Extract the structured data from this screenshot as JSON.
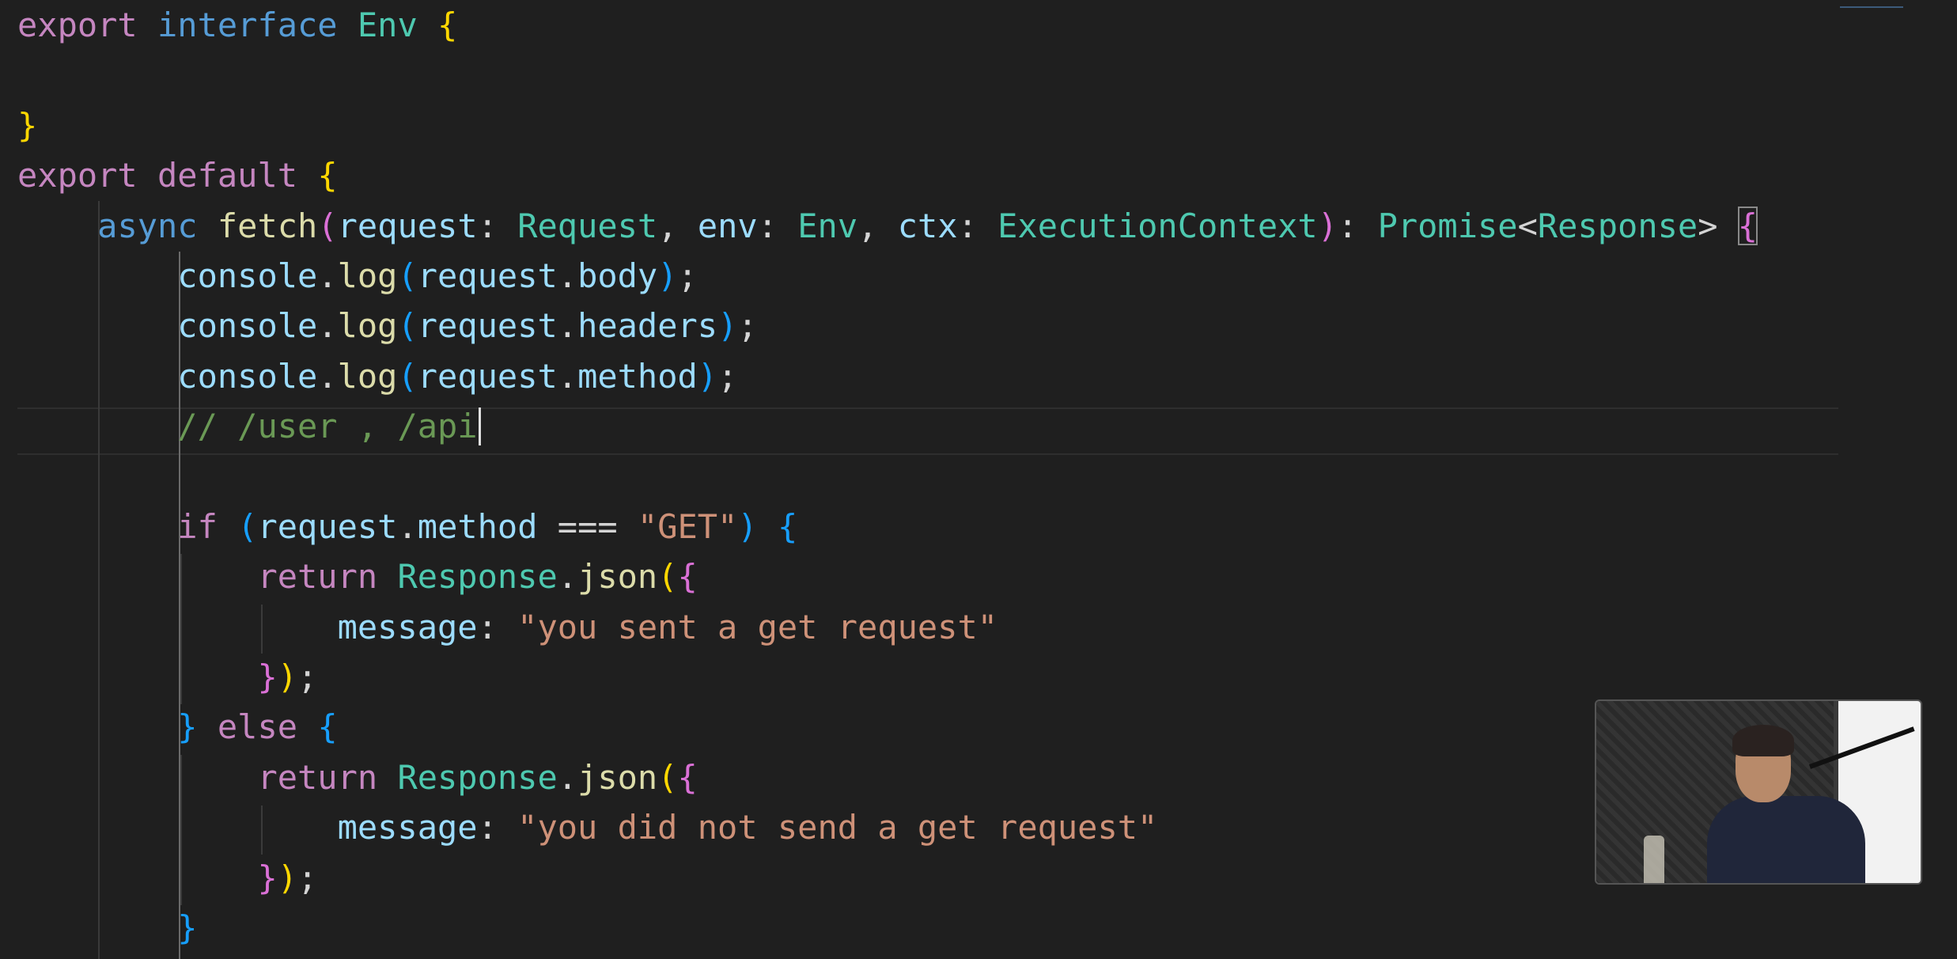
{
  "editor": {
    "code_lines": [
      [
        {
          "t": "export",
          "c": "kw"
        },
        {
          "t": " "
        },
        {
          "t": "interface",
          "c": "kw2"
        },
        {
          "t": " "
        },
        {
          "t": "Env",
          "c": "type"
        },
        {
          "t": " "
        },
        {
          "t": "{",
          "c": "b1"
        }
      ],
      [],
      [
        {
          "t": "}",
          "c": "b1"
        }
      ],
      [
        {
          "t": "export",
          "c": "kw"
        },
        {
          "t": " "
        },
        {
          "t": "default",
          "c": "kw"
        },
        {
          "t": " "
        },
        {
          "t": "{",
          "c": "b1"
        }
      ],
      [
        {
          "t": "    "
        },
        {
          "t": "async",
          "c": "kw2"
        },
        {
          "t": " "
        },
        {
          "t": "fetch",
          "c": "fn"
        },
        {
          "t": "(",
          "c": "b2"
        },
        {
          "t": "request",
          "c": "var"
        },
        {
          "t": ": "
        },
        {
          "t": "Request",
          "c": "type"
        },
        {
          "t": ", "
        },
        {
          "t": "env",
          "c": "var"
        },
        {
          "t": ": "
        },
        {
          "t": "Env",
          "c": "type"
        },
        {
          "t": ", "
        },
        {
          "t": "ctx",
          "c": "var"
        },
        {
          "t": ": "
        },
        {
          "t": "ExecutionContext",
          "c": "type"
        },
        {
          "t": ")",
          "c": "b2"
        },
        {
          "t": ": "
        },
        {
          "t": "Promise",
          "c": "type"
        },
        {
          "t": "<"
        },
        {
          "t": "Response",
          "c": "type"
        },
        {
          "t": ">"
        },
        {
          "t": " "
        },
        {
          "t": "{",
          "c": "b2 bracket-match"
        }
      ],
      [
        {
          "t": "        "
        },
        {
          "t": "console",
          "c": "var"
        },
        {
          "t": "."
        },
        {
          "t": "log",
          "c": "fn"
        },
        {
          "t": "(",
          "c": "b3"
        },
        {
          "t": "request",
          "c": "var"
        },
        {
          "t": "."
        },
        {
          "t": "body",
          "c": "var"
        },
        {
          "t": ")",
          "c": "b3"
        },
        {
          "t": ";"
        }
      ],
      [
        {
          "t": "        "
        },
        {
          "t": "console",
          "c": "var"
        },
        {
          "t": "."
        },
        {
          "t": "log",
          "c": "fn"
        },
        {
          "t": "(",
          "c": "b3"
        },
        {
          "t": "request",
          "c": "var"
        },
        {
          "t": "."
        },
        {
          "t": "headers",
          "c": "var"
        },
        {
          "t": ")",
          "c": "b3"
        },
        {
          "t": ";"
        }
      ],
      [
        {
          "t": "        "
        },
        {
          "t": "console",
          "c": "var"
        },
        {
          "t": "."
        },
        {
          "t": "log",
          "c": "fn"
        },
        {
          "t": "(",
          "c": "b3"
        },
        {
          "t": "request",
          "c": "var"
        },
        {
          "t": "."
        },
        {
          "t": "method",
          "c": "var"
        },
        {
          "t": ")",
          "c": "b3"
        },
        {
          "t": ";"
        }
      ],
      [
        {
          "t": "        "
        },
        {
          "t": "// /user , /api",
          "c": "cmt"
        },
        {
          "cursor": true
        }
      ],
      [],
      [
        {
          "t": "        "
        },
        {
          "t": "if",
          "c": "kw"
        },
        {
          "t": " "
        },
        {
          "t": "(",
          "c": "b3"
        },
        {
          "t": "request",
          "c": "var"
        },
        {
          "t": "."
        },
        {
          "t": "method",
          "c": "var"
        },
        {
          "t": " === "
        },
        {
          "t": "\"GET\"",
          "c": "str"
        },
        {
          "t": ")",
          "c": "b3"
        },
        {
          "t": " "
        },
        {
          "t": "{",
          "c": "b3"
        }
      ],
      [
        {
          "t": "            "
        },
        {
          "t": "return",
          "c": "kw"
        },
        {
          "t": " "
        },
        {
          "t": "Response",
          "c": "type"
        },
        {
          "t": "."
        },
        {
          "t": "json",
          "c": "fn"
        },
        {
          "t": "(",
          "c": "b1"
        },
        {
          "t": "{",
          "c": "b2"
        }
      ],
      [
        {
          "t": "                "
        },
        {
          "t": "message",
          "c": "var"
        },
        {
          "t": ": "
        },
        {
          "t": "\"you sent a get request\"",
          "c": "str"
        }
      ],
      [
        {
          "t": "            "
        },
        {
          "t": "}",
          "c": "b2"
        },
        {
          "t": ")",
          "c": "b1"
        },
        {
          "t": ";"
        }
      ],
      [
        {
          "t": "        "
        },
        {
          "t": "}",
          "c": "b3"
        },
        {
          "t": " "
        },
        {
          "t": "else",
          "c": "kw"
        },
        {
          "t": " "
        },
        {
          "t": "{",
          "c": "b3"
        }
      ],
      [
        {
          "t": "            "
        },
        {
          "t": "return",
          "c": "kw"
        },
        {
          "t": " "
        },
        {
          "t": "Response",
          "c": "type"
        },
        {
          "t": "."
        },
        {
          "t": "json",
          "c": "fn"
        },
        {
          "t": "(",
          "c": "b1"
        },
        {
          "t": "{",
          "c": "b2"
        }
      ],
      [
        {
          "t": "                "
        },
        {
          "t": "message",
          "c": "var"
        },
        {
          "t": ": "
        },
        {
          "t": "\"you did not send a get request\"",
          "c": "str"
        }
      ],
      [
        {
          "t": "            "
        },
        {
          "t": "}",
          "c": "b2"
        },
        {
          "t": ")",
          "c": "b1"
        },
        {
          "t": ";"
        }
      ],
      [
        {
          "t": "        "
        },
        {
          "t": "}",
          "c": "b3"
        }
      ]
    ]
  },
  "colors": {
    "background": "#1f1f1f",
    "keyword": "#c586c0",
    "storage": "#569cd6",
    "type": "#4ec9b0",
    "function": "#dcdcaa",
    "variable": "#9cdcfe",
    "string": "#ce9178",
    "comment": "#6a9955"
  },
  "webcam": {
    "icon": "webcam-overlay"
  }
}
